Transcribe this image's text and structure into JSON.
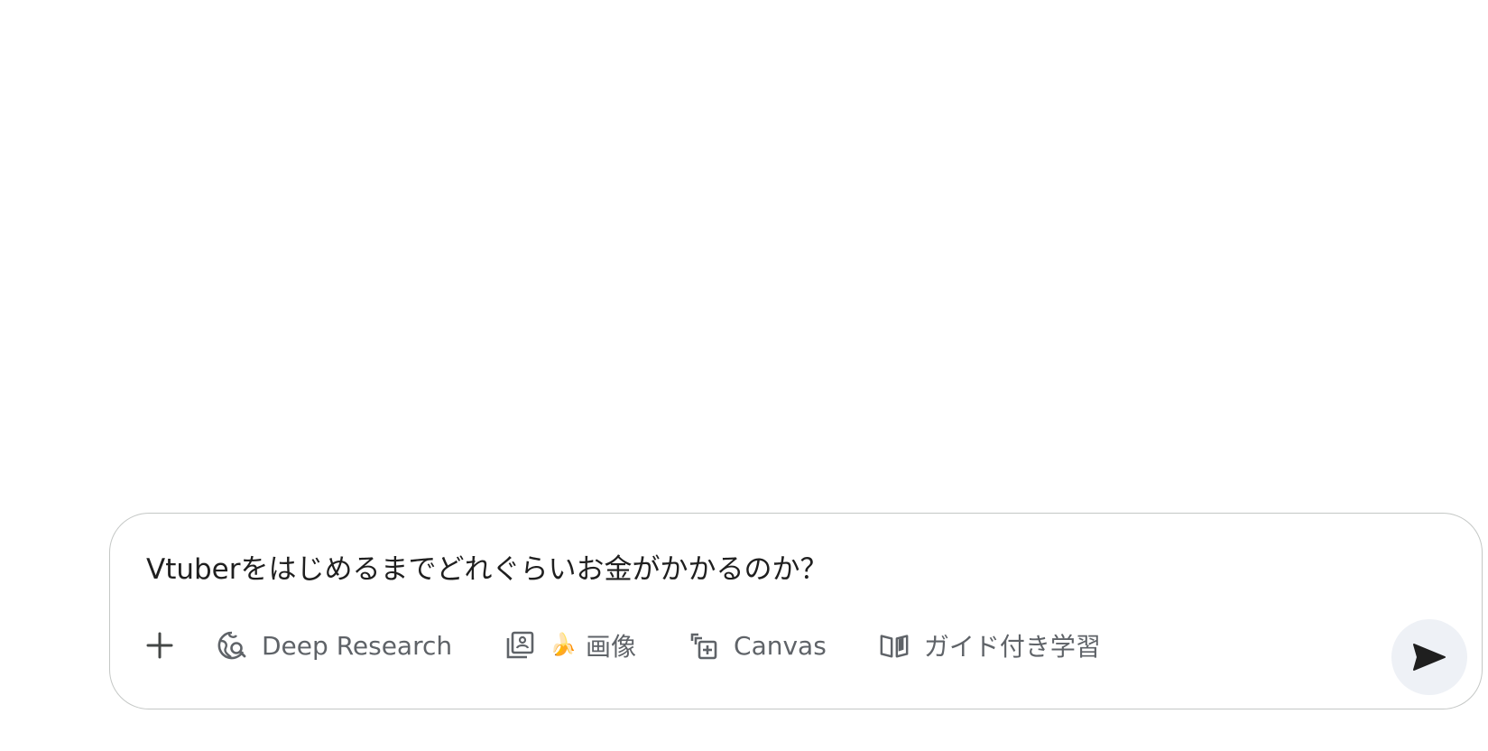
{
  "composer": {
    "prompt_text": "Vtuberをはじめるまでどれぐらいお金がかかるのか？",
    "add_icon": "plus-icon",
    "send_icon": "send-arrow-icon",
    "tools": [
      {
        "label": "Deep Research",
        "icon": "globe-search-icon"
      },
      {
        "label": "画像",
        "icon": "image-gallery-icon",
        "emoji": "🍌"
      },
      {
        "label": "Canvas",
        "icon": "canvas-add-icon"
      },
      {
        "label": "ガイド付き学習",
        "icon": "book-open-icon"
      }
    ]
  },
  "colors": {
    "border": "#c4c7c5",
    "text": "#1f1f1f",
    "muted": "#5f6368",
    "send_bg": "#eef1f6",
    "send_icon": "#1f1f1f"
  }
}
